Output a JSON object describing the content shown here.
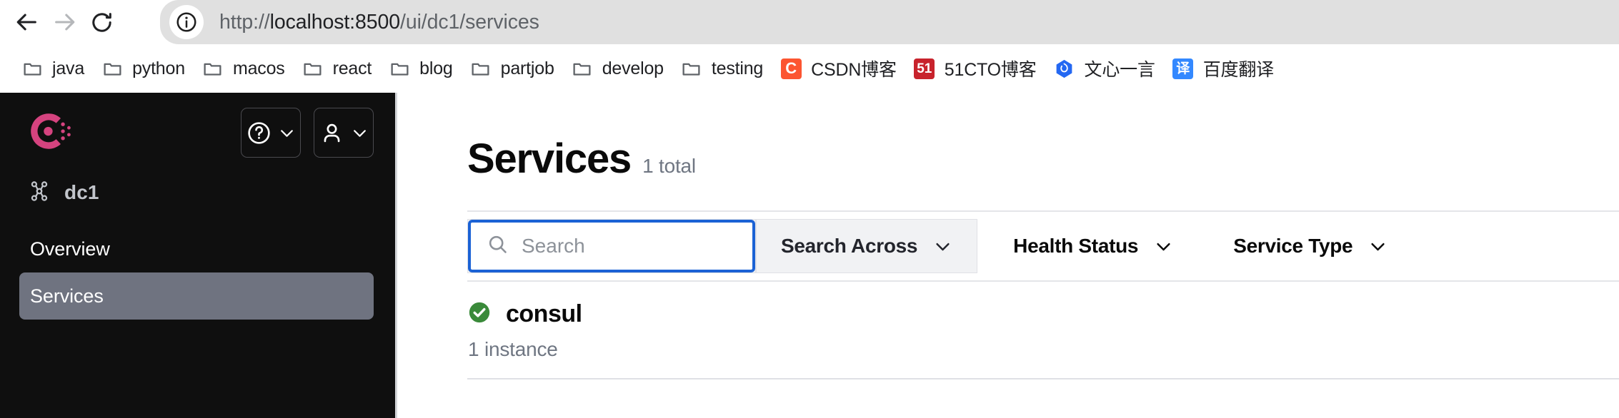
{
  "browser": {
    "back_label": "Back",
    "forward_label": "Forward",
    "reload_label": "Reload",
    "site_info_label": "View site information",
    "url_scheme": "http://",
    "url_host": "localhost:8500",
    "url_path": "/ui/dc1/services",
    "url_full": "http://localhost:8500/ui/dc1/services"
  },
  "bookmarks": [
    {
      "label": "java",
      "icon": "folder-icon",
      "type": "folder"
    },
    {
      "label": "python",
      "icon": "folder-icon",
      "type": "folder"
    },
    {
      "label": "macos",
      "icon": "folder-icon",
      "type": "folder"
    },
    {
      "label": "react",
      "icon": "folder-icon",
      "type": "folder"
    },
    {
      "label": "blog",
      "icon": "folder-icon",
      "type": "folder"
    },
    {
      "label": "partjob",
      "icon": "folder-icon",
      "type": "folder"
    },
    {
      "label": "develop",
      "icon": "folder-icon",
      "type": "folder"
    },
    {
      "label": "testing",
      "icon": "folder-icon",
      "type": "folder"
    },
    {
      "label": "CSDN博客",
      "icon": "csdn-icon",
      "type": "site",
      "glyph": "C",
      "color": "#fc5531"
    },
    {
      "label": "51CTO博客",
      "icon": "51cto-icon",
      "type": "site",
      "glyph": "51",
      "color": "#c8232c"
    },
    {
      "label": "文心一言",
      "icon": "ernie-icon",
      "type": "site",
      "glyph": "",
      "color": "#2468f2"
    },
    {
      "label": "百度翻译",
      "icon": "baidu-fanyi-icon",
      "type": "site",
      "glyph": "译",
      "color": "#3388ff"
    }
  ],
  "sidebar": {
    "logo_name": "consul-logo",
    "help_button_label": "Help",
    "user_button_label": "User menu",
    "datacenter": "dc1",
    "datacenter_icon": "datacenter-icon",
    "nav": [
      {
        "label": "Overview",
        "active": false
      },
      {
        "label": "Services",
        "active": true
      }
    ]
  },
  "main": {
    "title": "Services",
    "count_label": "1 total",
    "search": {
      "placeholder": "Search",
      "value": "",
      "icon": "search-icon"
    },
    "filters": [
      {
        "label": "Search Across",
        "icon": "chevron-down-icon",
        "style": "filled"
      },
      {
        "label": "Health Status",
        "icon": "chevron-down-icon",
        "style": "plain"
      },
      {
        "label": "Service Type",
        "icon": "chevron-down-icon",
        "style": "plain"
      }
    ],
    "services": [
      {
        "name": "consul",
        "health": "passing",
        "health_icon": "check-circle-icon",
        "health_color": "#3a8a3a",
        "instances": "1 instance"
      }
    ]
  },
  "colors": {
    "sidebar_bg": "#0f0f0f",
    "nav_active_bg": "#6f7380",
    "focus_border": "#1b62d5",
    "consul_brand": "#d5437f",
    "health_pass": "#3a8a3a"
  }
}
